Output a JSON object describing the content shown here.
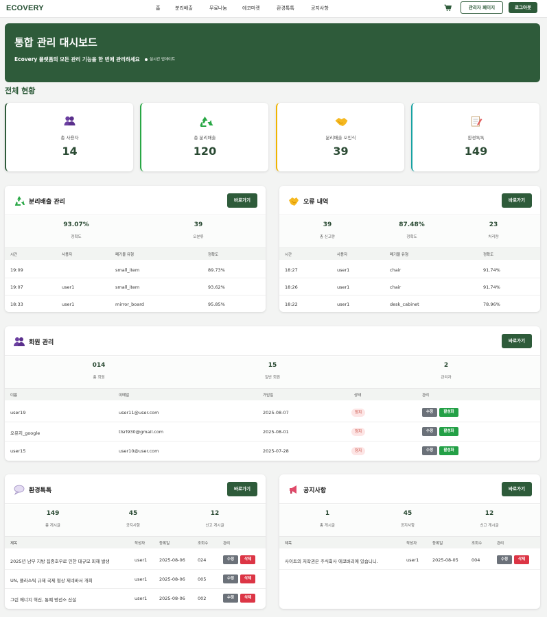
{
  "nav": {
    "logo": "ECOVERY",
    "links": [
      "홈",
      "분리배출",
      "무료나눔",
      "에코마켓",
      "환경톡톡",
      "공지사항"
    ],
    "cart_icon": "cart-icon",
    "admin_page": "관리자 페이지",
    "logout": "로그아웃"
  },
  "hero": {
    "title": "통합 관리 대시보드",
    "subtitle": "Ecovery 플랫폼의 모든 관리 기능을 한 번에 관리하세요",
    "live": "실시간 업데이트"
  },
  "overview": {
    "title": "전체 현황",
    "cards": [
      {
        "icon": "users-icon",
        "label": "총 사용자",
        "value": "14",
        "accent": "#2e5b3a"
      },
      {
        "icon": "recycle-icon",
        "label": "총 분리배출",
        "value": "120",
        "accent": "#28a745"
      },
      {
        "icon": "handshake-icon",
        "label": "분리배출 오인식",
        "value": "39",
        "accent": "#f0b400"
      },
      {
        "icon": "memo-icon",
        "label": "환경톡톡",
        "value": "149",
        "accent": "#17a2a2"
      }
    ]
  },
  "go_label": "바로가기",
  "recycle": {
    "title": "분리배출 관리",
    "stats": [
      {
        "value": "93.07%",
        "label": "정확도"
      },
      {
        "value": "39",
        "label": "오분류"
      }
    ],
    "columns": [
      "시간",
      "사용자",
      "폐기물 유형",
      "정확도"
    ],
    "rows": [
      [
        "19:09",
        "",
        "small_item",
        "89.73%"
      ],
      [
        "19:07",
        "user1",
        "small_item",
        "93.62%"
      ],
      [
        "18:33",
        "user1",
        "mirror_board",
        "95.85%"
      ]
    ]
  },
  "errors": {
    "title": "오류 내역",
    "stats": [
      {
        "value": "39",
        "label": "총 신고량"
      },
      {
        "value": "87.48%",
        "label": "정확도"
      },
      {
        "value": "23",
        "label": "처리량"
      }
    ],
    "columns": [
      "시간",
      "사용자",
      "폐기물 유형",
      "정확도"
    ],
    "rows": [
      [
        "18:27",
        "user1",
        "chair",
        "91.74%"
      ],
      [
        "18:26",
        "user1",
        "chair",
        "91.74%"
      ],
      [
        "18:22",
        "user1",
        "desk_cabinet",
        "78.96%"
      ]
    ]
  },
  "members": {
    "title": "회원 관리",
    "stats": [
      {
        "value": "014",
        "label": "총 회원"
      },
      {
        "value": "15",
        "label": "일반 회원"
      },
      {
        "value": "2",
        "label": "관리자"
      }
    ],
    "columns": [
      "이름",
      "이메일",
      "가입일",
      "상태",
      "관리"
    ],
    "rows": [
      {
        "name": "user19",
        "email": "user11@user.com",
        "joined": "2025-08-07",
        "status": "정지"
      },
      {
        "name": "오유지_google",
        "email": "tlsrl930@gmail.com",
        "joined": "2025-08-01",
        "status": "정지"
      },
      {
        "name": "user15",
        "email": "user10@user.com",
        "joined": "2025-07-28",
        "status": "정지"
      }
    ],
    "edit": "수정",
    "activate": "활성화"
  },
  "talk": {
    "title": "환경톡톡",
    "stats": [
      {
        "value": "149",
        "label": "총 게시글"
      },
      {
        "value": "45",
        "label": "공지사항"
      },
      {
        "value": "12",
        "label": "신고 게시글"
      }
    ],
    "columns": [
      "제목",
      "작성자",
      "등록일",
      "조회수",
      "관리"
    ],
    "rows": [
      [
        "2025년 남부 지방 집중호우로 인한 대규모 피해 발생",
        "user1",
        "2025-08-06",
        "024"
      ],
      [
        "UN, 플라스틱 규제 국제 협상 제네바서 개최",
        "user1",
        "2025-08-06",
        "005"
      ],
      [
        "그린 에너지 혁신, 통폐 방선소 신설",
        "user1",
        "2025-08-06",
        "002"
      ]
    ],
    "edit": "수정",
    "delete": "삭제"
  },
  "notice": {
    "title": "공지사항",
    "stats": [
      {
        "value": "1",
        "label": "총 게시글"
      },
      {
        "value": "45",
        "label": "공지사항"
      },
      {
        "value": "12",
        "label": "신고 게시글"
      }
    ],
    "columns": [
      "제목",
      "작성자",
      "등록일",
      "조회수",
      "관리"
    ],
    "rows": [
      [
        "사이트의 저작권은 주식회사 에코버리에 있습니니.",
        "user1",
        "2025-08-05",
        "004"
      ]
    ],
    "edit": "수정",
    "delete": "삭제"
  }
}
